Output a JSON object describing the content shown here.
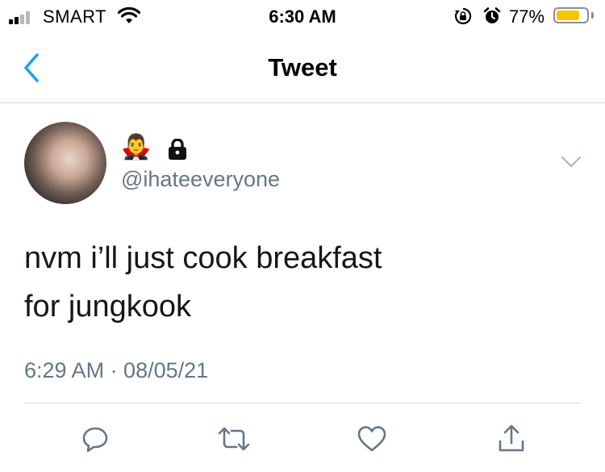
{
  "status_bar": {
    "carrier": "SMART",
    "time": "6:30 AM",
    "battery_percent": "77%",
    "battery_level": 0.77,
    "battery_color": "#f5c600",
    "icons": [
      "signal-icon",
      "wifi-icon",
      "rotation-lock-icon",
      "alarm-icon",
      "battery-icon"
    ]
  },
  "nav": {
    "title": "Tweet",
    "back_icon": "chevron-left-icon",
    "accent_color": "#1da1f2"
  },
  "tweet": {
    "display_name_emojis": "🧛‍♂️",
    "protected_icon": "lock-icon",
    "handle": "@ihateeveryone",
    "text_lines": [
      "nvm i’ll just cook breakfast",
      "for jungkook"
    ],
    "timestamp": "6:29 AM · 08/05/21",
    "menu_icon": "chevron-down-icon"
  },
  "actions": [
    {
      "icon": "reply-icon"
    },
    {
      "icon": "retweet-icon"
    },
    {
      "icon": "heart-icon"
    },
    {
      "icon": "share-icon"
    }
  ],
  "colors": {
    "text": "#14171a",
    "secondary_text": "#657786",
    "accent": "#1da1f2",
    "divider": "#d6dbdf"
  }
}
